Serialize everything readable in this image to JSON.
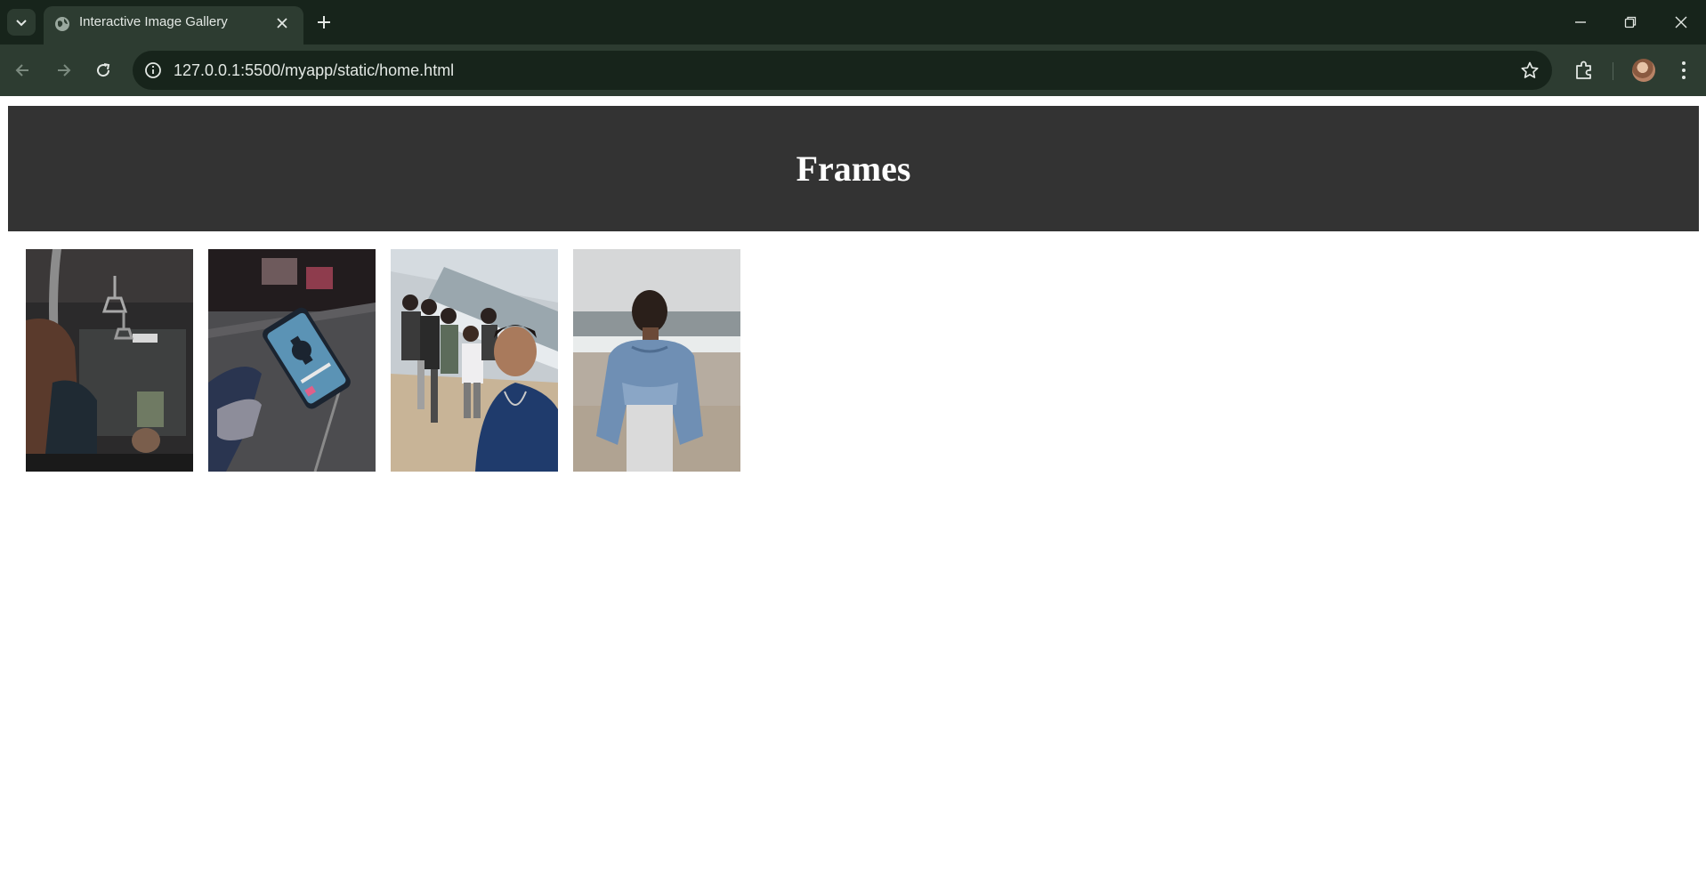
{
  "browser": {
    "tab_title": "Interactive Image Gallery",
    "url": "127.0.0.1:5500/myapp/static/home.html",
    "icons": {
      "tab_search": "chevron-down-icon",
      "favicon": "globe-icon",
      "tab_close": "close-icon",
      "new_tab": "plus-icon",
      "minimize": "minimize-icon",
      "restore": "restore-icon",
      "close_window": "close-icon",
      "back": "arrow-left-icon",
      "forward": "arrow-right-icon",
      "reload": "reload-icon",
      "site_info": "info-icon",
      "bookmark": "star-icon",
      "extensions": "puzzle-icon",
      "menu": "kebab-menu-icon"
    },
    "colors": {
      "frame": "#17241b",
      "toolbar": "#2d3c31",
      "text": "#e3e8e4"
    }
  },
  "page": {
    "heading": "Frames",
    "header_color": "#333333",
    "gallery": [
      {
        "subject": "train-interior-hand-on-rail"
      },
      {
        "subject": "hand-holding-phone-on-street"
      },
      {
        "subject": "group-selfie-on-beach"
      },
      {
        "subject": "person-in-denim-jacket-facing-sea"
      }
    ]
  }
}
